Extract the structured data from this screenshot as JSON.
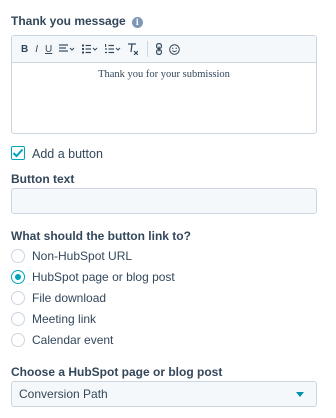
{
  "thank_you": {
    "label": "Thank you message",
    "info_icon": "info-icon",
    "body_text": "Thank you for your submission"
  },
  "toolbar": {
    "bold": "B",
    "italic": "I",
    "underline": "U",
    "items": [
      "bold-icon",
      "italic-icon",
      "underline-icon",
      "align-icon",
      "bulleted-list-icon",
      "numbered-list-icon",
      "clear-format-icon",
      "link-icon",
      "emoji-icon"
    ]
  },
  "add_button": {
    "checked": true,
    "label": "Add a button"
  },
  "button_text": {
    "label": "Button text",
    "value": ""
  },
  "link_to": {
    "label": "What should the button link to?",
    "selected": "HubSpot page or blog post",
    "options": [
      "Non-HubSpot URL",
      "HubSpot page or blog post",
      "File download",
      "Meeting link",
      "Calendar event"
    ]
  },
  "choose_page": {
    "label": "Choose a HubSpot page or blog post",
    "value": "Conversion Path"
  },
  "colors": {
    "accent": "#00a4bd",
    "text": "#33475b",
    "border": "#cbd6e2",
    "input_bg": "#f5f8fa"
  }
}
